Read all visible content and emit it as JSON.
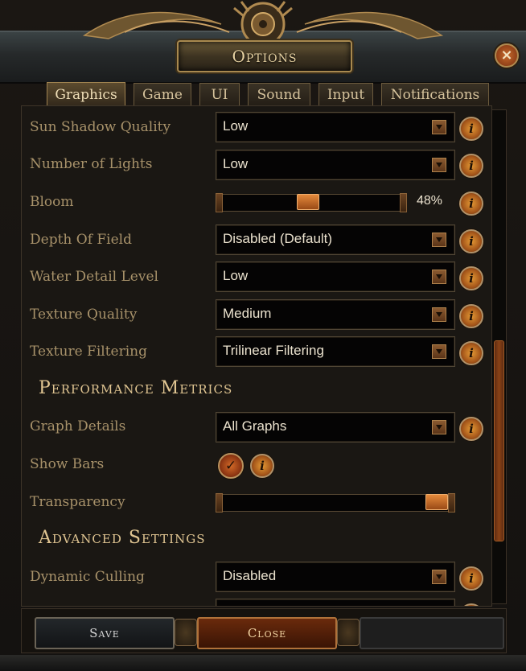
{
  "window": {
    "title": "Options",
    "close_icon": "×"
  },
  "tabs": [
    {
      "label": "Graphics",
      "active": true
    },
    {
      "label": "Game",
      "active": false
    },
    {
      "label": "UI",
      "active": false
    },
    {
      "label": "Sound",
      "active": false
    },
    {
      "label": "Input",
      "active": false
    },
    {
      "label": "Notifications",
      "active": false
    }
  ],
  "settings": {
    "sun_shadow_quality": {
      "label": "Sun Shadow Quality",
      "value": "Low"
    },
    "number_of_lights": {
      "label": "Number of Lights",
      "value": "Low"
    },
    "bloom": {
      "label": "Bloom",
      "percent": "48%",
      "level": 0.48
    },
    "depth_of_field": {
      "label": "Depth Of Field",
      "value": "Disabled (Default)"
    },
    "water_detail_level": {
      "label": "Water Detail Level",
      "value": "Low"
    },
    "texture_quality": {
      "label": "Texture Quality",
      "value": "Medium"
    },
    "texture_filtering": {
      "label": "Texture Filtering",
      "value": "Trilinear Filtering"
    }
  },
  "performance_metrics": {
    "heading": "Performance Metrics",
    "graph_details": {
      "label": "Graph Details",
      "value": "All Graphs"
    },
    "show_bars": {
      "label": "Show Bars",
      "checked": true
    },
    "transparency": {
      "label": "Transparency",
      "level": 1.0
    }
  },
  "advanced_settings": {
    "heading": "Advanced Settings",
    "dynamic_culling": {
      "label": "Dynamic Culling",
      "value": "Disabled"
    }
  },
  "info_icon": "i",
  "check_icon": "✓",
  "footer": {
    "save_label": "Save",
    "close_label": "Close"
  },
  "colors": {
    "accent": "#c7621f",
    "label_text": "#a8926a",
    "heading_text": "#e0c592"
  }
}
